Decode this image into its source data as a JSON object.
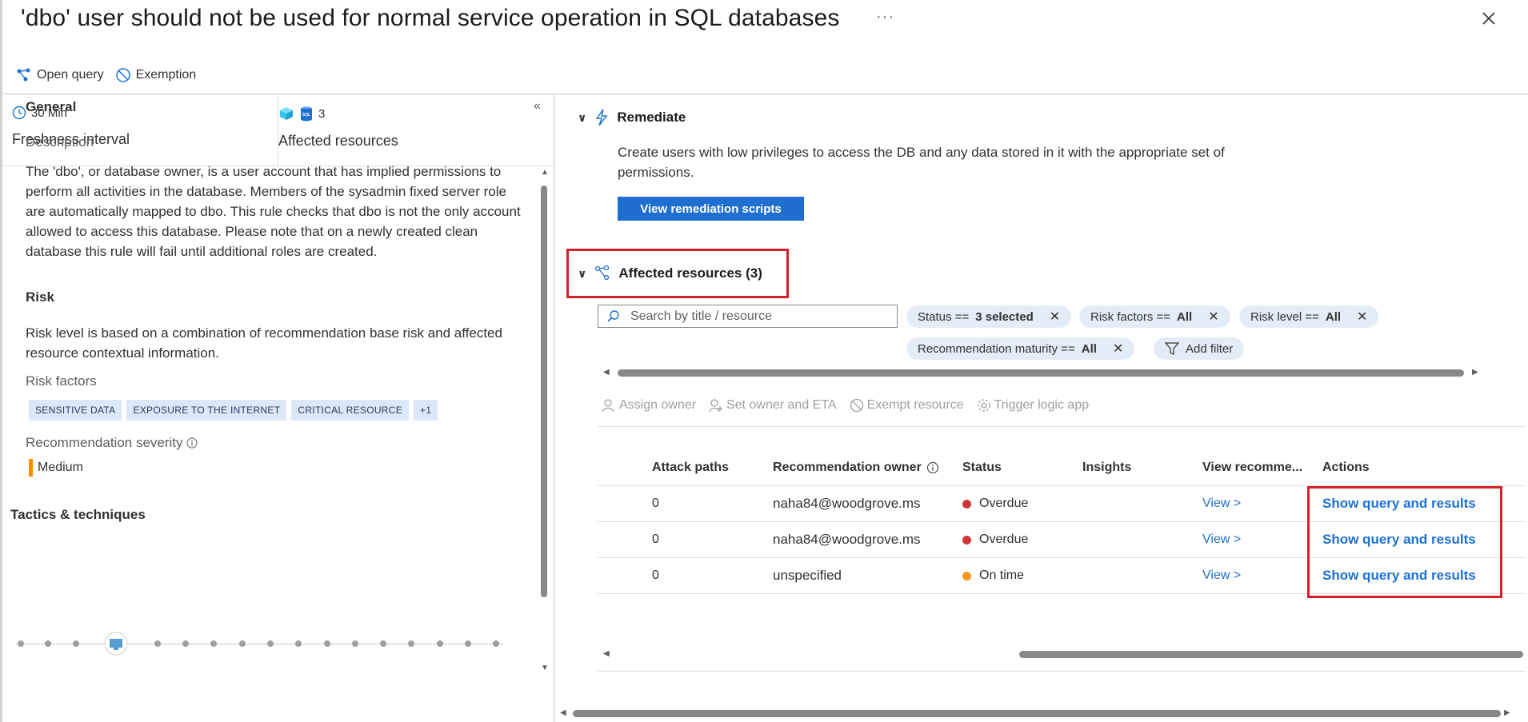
{
  "header": {
    "title": "'dbo' user should not be used for normal service operation in SQL databases",
    "more": "···"
  },
  "toolbar": {
    "open_query": "Open query",
    "exemption": "Exemption"
  },
  "stats": {
    "freshness_value": "30 Min",
    "freshness_label": "Freshness interval",
    "affected_value": "3",
    "affected_label": "Affected resources",
    "sql_badge": "SQL"
  },
  "general": {
    "heading": "General",
    "description_label": "Description",
    "description": "The 'dbo', or database owner, is a user account that has implied permissions to perform all activities in the database. Members of the sysadmin fixed server role are automatically mapped to dbo. This rule checks that dbo is not the only account allowed to access this database. Please note that on a newly created clean database this rule will fail until additional roles are created."
  },
  "risk": {
    "heading": "Risk",
    "text": "Risk level is based on a combination of recommendation base risk and affected resource contextual information.",
    "factors_label": "Risk factors",
    "factors": [
      "SENSITIVE DATA",
      "EXPOSURE TO THE INTERNET",
      "CRITICAL RESOURCE",
      "+1"
    ],
    "severity_label": "Recommendation severity",
    "severity": "Medium",
    "severity_color": "#ff8c00"
  },
  "tactics": {
    "heading": "Tactics & techniques"
  },
  "remediate": {
    "heading": "Remediate",
    "text": "Create users with low privileges to access the DB and any data stored in it with the appropriate set of permissions.",
    "button": "View remediation scripts"
  },
  "affected": {
    "heading": "Affected resources (3)",
    "search_placeholder": "Search by title / resource",
    "filters": [
      {
        "name": "Status ==",
        "value": "3 selected"
      },
      {
        "name": "Risk factors ==",
        "value": "All"
      },
      {
        "name": "Risk level ==",
        "value": "All"
      },
      {
        "name": "Recommendation maturity ==",
        "value": "All"
      }
    ],
    "add_filter": "Add filter",
    "actions": [
      "Assign owner",
      "Set owner and ETA",
      "Exempt resource",
      "Trigger logic app"
    ],
    "columns": [
      "Attack paths",
      "Recommendation owner",
      "Status",
      "Insights",
      "View recomme...",
      "Actions"
    ],
    "rows": [
      {
        "attack_paths": "0",
        "owner": "naha84@woodgrove.ms",
        "status": "Overdue",
        "status_color": "#d13438",
        "view": "View >",
        "action": "Show query and results"
      },
      {
        "attack_paths": "0",
        "owner": "naha84@woodgrove.ms",
        "status": "Overdue",
        "status_color": "#d13438",
        "view": "View >",
        "action": "Show query and results"
      },
      {
        "attack_paths": "0",
        "owner": "unspecified",
        "status": "On time",
        "status_color": "#f7941d",
        "view": "View >",
        "action": "Show query and results"
      }
    ]
  },
  "colors": {
    "accent": "#1f6fd1",
    "highlight": "#d4202a"
  }
}
